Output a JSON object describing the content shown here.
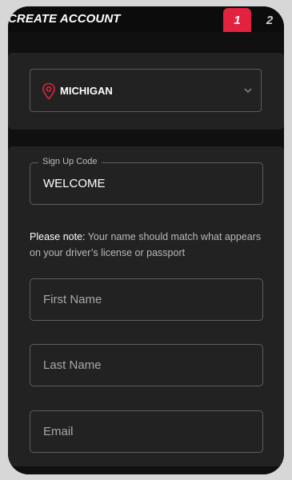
{
  "header": {
    "title": "CREATE ACCOUNT",
    "steps": [
      "1",
      "2"
    ]
  },
  "state_select": {
    "value": "MICHIGAN",
    "icon": "location-pin-icon"
  },
  "form": {
    "signup_code": {
      "label": "Sign Up Code",
      "value": "WELCOME"
    },
    "note": {
      "label": "Please note:",
      "text": " Your name should match what appears on your driver’s license or passport"
    },
    "first_name": {
      "placeholder": "First Name"
    },
    "last_name": {
      "placeholder": "Last Name"
    },
    "email": {
      "placeholder": "Email"
    }
  },
  "colors": {
    "accent": "#e2223f",
    "background": "#101010",
    "card": "#222222"
  }
}
